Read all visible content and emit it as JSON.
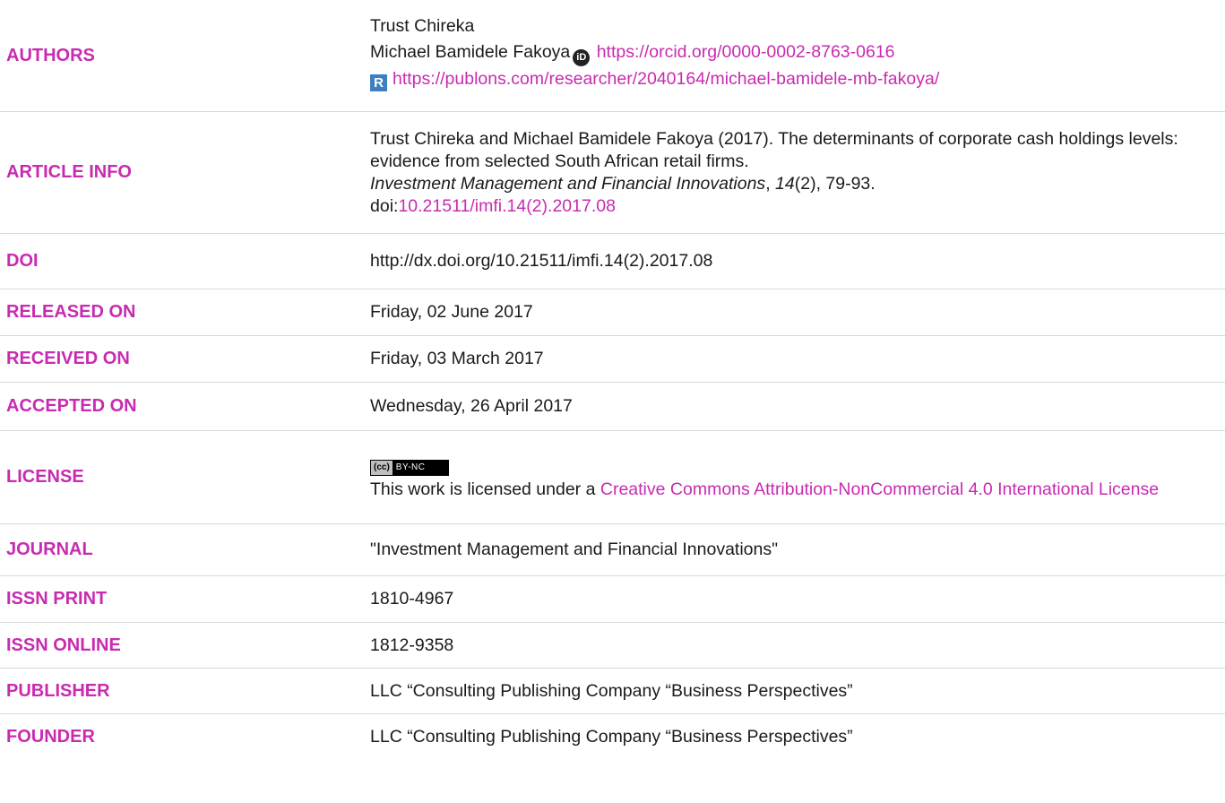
{
  "rows": {
    "authors": {
      "label": "AUTHORS",
      "author1": "Trust Chireka",
      "author2": "Michael Bamidele Fakoya",
      "orcid_url": "https://orcid.org/0000-0002-8763-0616",
      "publons_url": "https://publons.com/researcher/2040164/michael-bamidele-mb-fakoya/"
    },
    "article_info": {
      "label": "ARTICLE INFO",
      "citation_text": "Trust Chireka and Michael Bamidele Fakoya (2017). The determinants of corporate cash holdings levels: evidence from selected South African retail firms.",
      "journal": "Investment Management and Financial Innovations",
      "comma1": ", ",
      "volume": "14",
      "issue_pages": "(2), 79-93.",
      "doi_prefix": "doi:",
      "doi_link": "10.21511/imfi.14(2).2017.08"
    },
    "doi": {
      "label": "DOI",
      "value": "http://dx.doi.org/10.21511/imfi.14(2).2017.08"
    },
    "released_on": {
      "label": "RELEASED ON",
      "value": "Friday, 02 June 2017"
    },
    "received_on": {
      "label": "RECEIVED ON",
      "value": "Friday, 03 March 2017"
    },
    "accepted_on": {
      "label": "ACCEPTED ON",
      "value": "Wednesday, 26 April 2017"
    },
    "license": {
      "label": "LICENSE",
      "badge_left": "(cc)",
      "badge_right": "BY-NC",
      "text_prefix": "This work is licensed under a ",
      "link_text": "Creative Commons Attribution-NonCommercial 4.0 International License"
    },
    "journal": {
      "label": "JOURNAL",
      "value": "\"Investment Management and Financial Innovations\""
    },
    "issn_print": {
      "label": "ISSN PRINT",
      "value": "1810-4967"
    },
    "issn_online": {
      "label": "ISSN ONLINE",
      "value": "1812-9358"
    },
    "publisher": {
      "label": "PUBLISHER",
      "value": "LLC “Consulting Publishing Company “Business Perspectives”"
    },
    "founder": {
      "label": "FOUNDER",
      "value": "LLC “Consulting Publishing Company “Business Perspectives”"
    }
  },
  "colors": {
    "accent": "#c82bb0",
    "text": "#1a1a1a",
    "divider": "#d9d9d9"
  },
  "icons": {
    "orcid": "orcid-icon",
    "publons": "publons-icon",
    "cc_license": "cc-by-nc-badge"
  }
}
